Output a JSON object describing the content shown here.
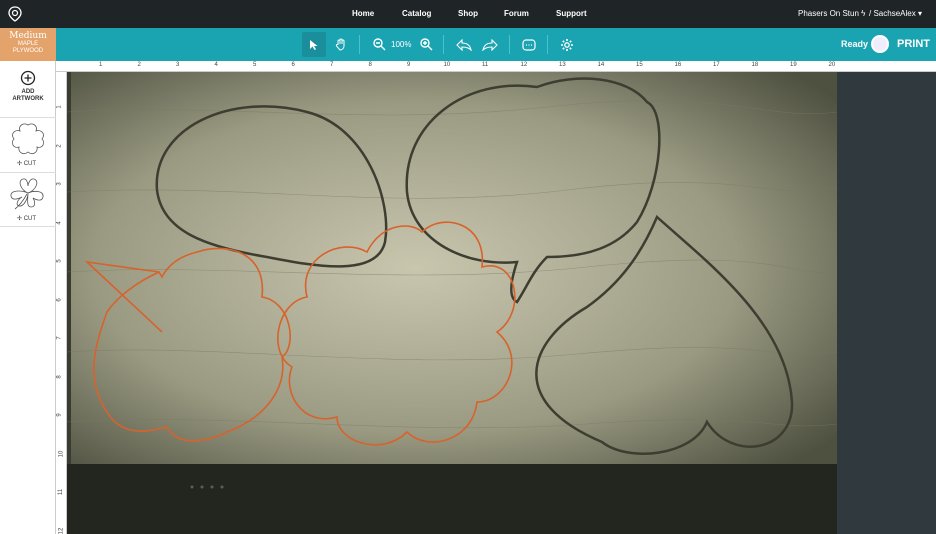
{
  "nav": {
    "links": [
      "Home",
      "Catalog",
      "Shop",
      "Forum",
      "Support"
    ],
    "device": "Phasers On Stun",
    "user": "SachseAlex"
  },
  "material": {
    "line1": "Medium",
    "line2": "MAPLE",
    "line3": "PLYWOOD"
  },
  "toolbar": {
    "zoom": "100%",
    "status": "Ready",
    "print": "PRINT"
  },
  "sidebar": {
    "add_label_1": "ADD",
    "add_label_2": "ARTWORK",
    "items": [
      {
        "label": "CUT"
      },
      {
        "label": "CUT"
      }
    ]
  },
  "ruler": {
    "top": [
      "1",
      "2",
      "3",
      "4",
      "5",
      "6",
      "7",
      "8",
      "9",
      "10",
      "11",
      "12",
      "13",
      "14",
      "15",
      "16",
      "17",
      "18",
      "19",
      "20"
    ],
    "left": [
      "1",
      "2",
      "3",
      "4",
      "5",
      "6",
      "7",
      "8",
      "9",
      "10",
      "11",
      "12"
    ]
  },
  "colors": {
    "teal": "#1aa3b1",
    "material": "#e4a36a",
    "cutline": "#d8622c"
  }
}
